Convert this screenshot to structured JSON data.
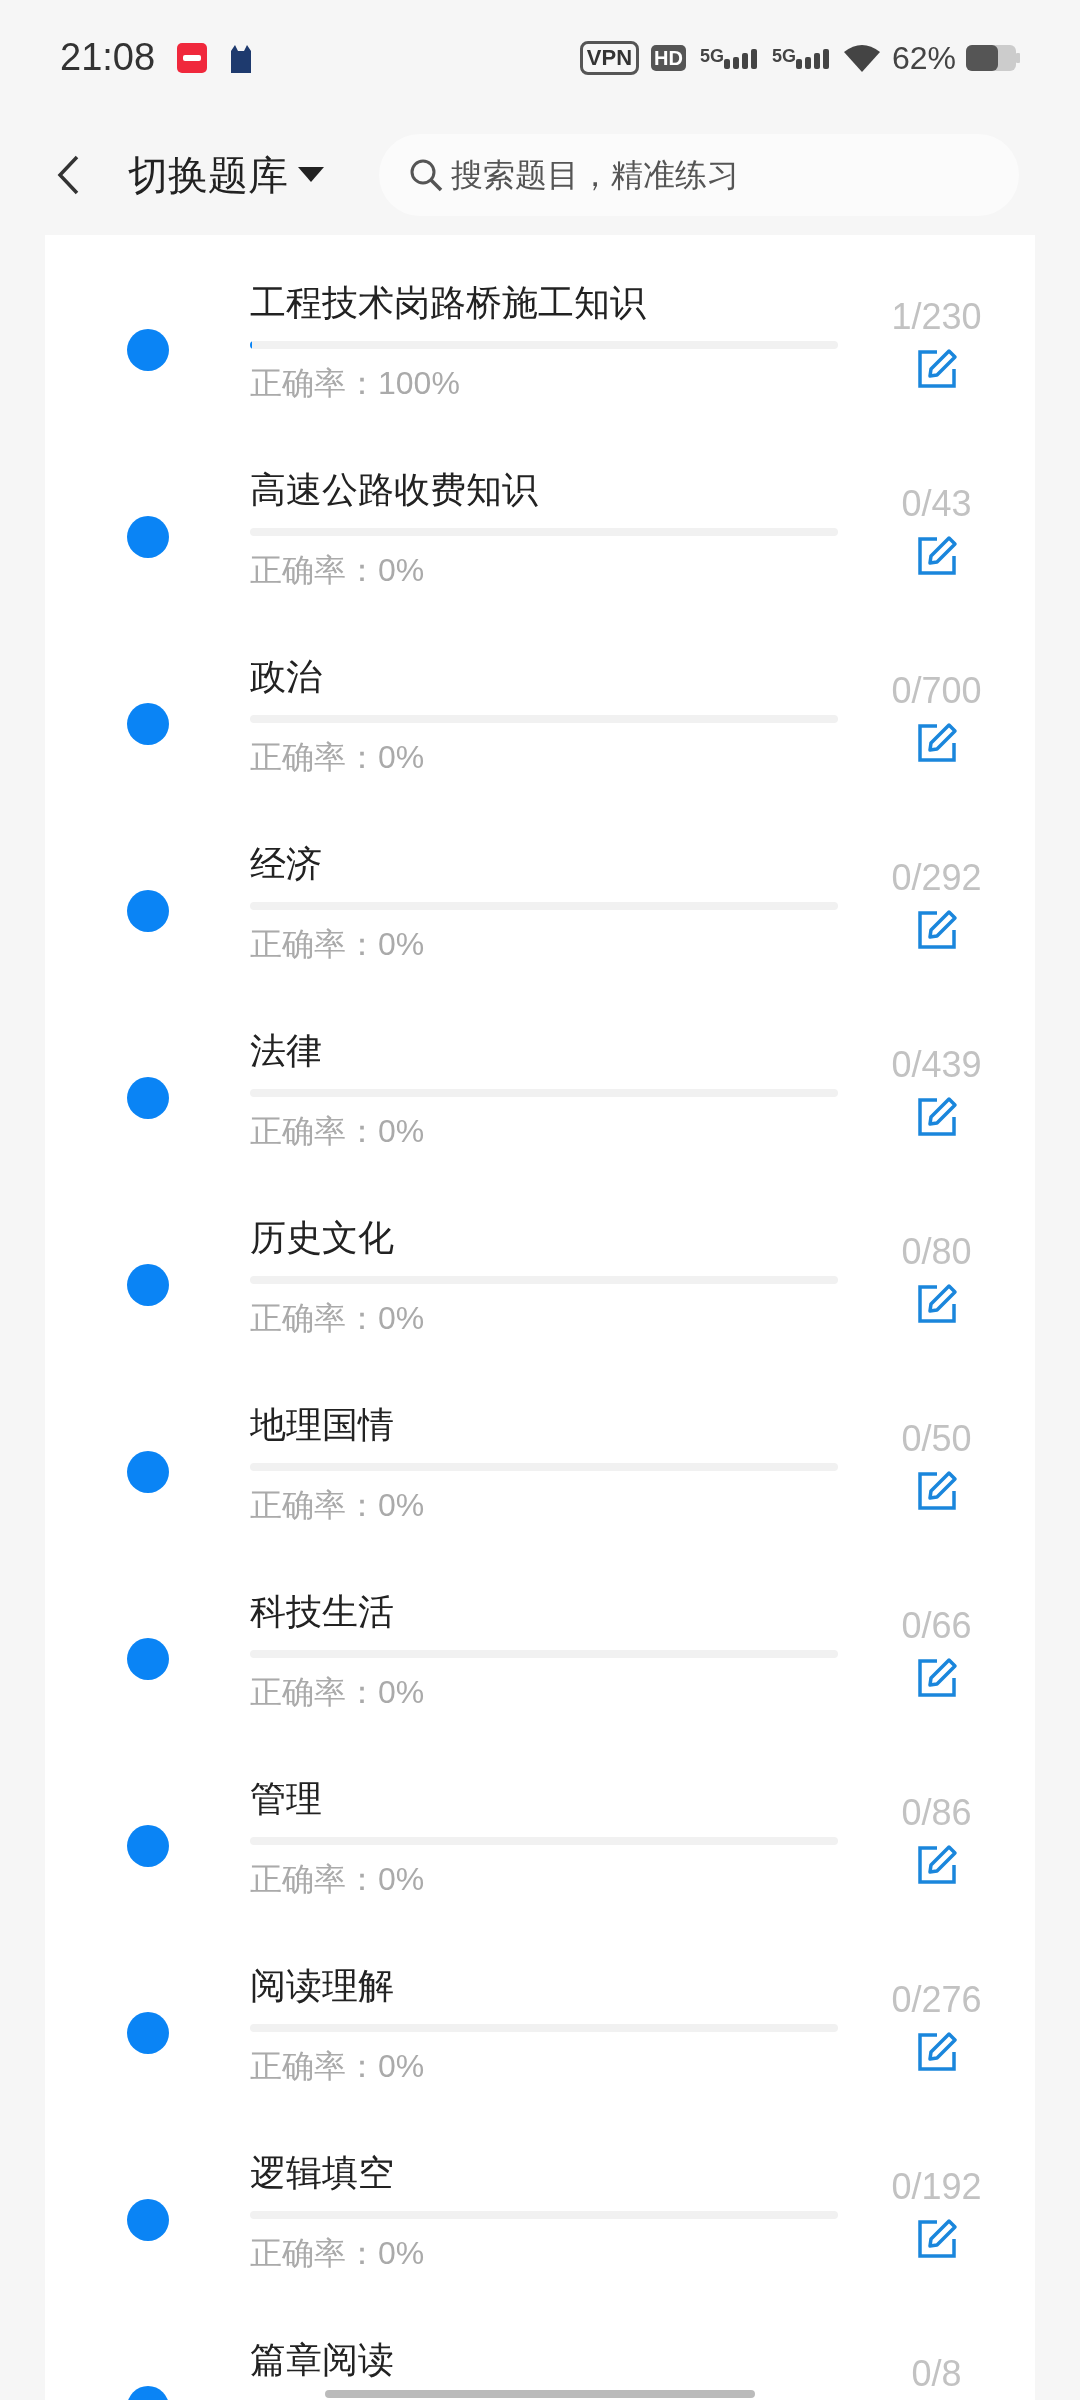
{
  "status_bar": {
    "time": "21:08",
    "vpn": "VPN",
    "hd": "HD",
    "network_labels": [
      "5G",
      "5G"
    ],
    "battery": "62%"
  },
  "header": {
    "title": "切换题库",
    "search": {
      "placeholder": "搜索题目，精准练习"
    }
  },
  "banks": [
    {
      "name": "工程技术岗路桥施工知识",
      "level": 0.004,
      "accuracy": "正确率：100%",
      "count": "1/230"
    },
    {
      "name": "高速公路收费知识",
      "level": 0,
      "accuracy": "正确率：0%",
      "count": "0/43"
    },
    {
      "name": "政治",
      "level": 0,
      "accuracy": "正确率：0%",
      "count": "0/700"
    },
    {
      "name": "经济",
      "level": 0,
      "accuracy": "正确率：0%",
      "count": "0/292"
    },
    {
      "name": "法律",
      "level": 0,
      "accuracy": "正确率：0%",
      "count": "0/439"
    },
    {
      "name": "历史文化",
      "level": 0,
      "accuracy": "正确率：0%",
      "count": "0/80"
    },
    {
      "name": "地理国情",
      "level": 0,
      "accuracy": "正确率：0%",
      "count": "0/50"
    },
    {
      "name": "科技生活",
      "level": 0,
      "accuracy": "正确率：0%",
      "count": "0/66"
    },
    {
      "name": "管理",
      "level": 0,
      "accuracy": "正确率：0%",
      "count": "0/86"
    },
    {
      "name": "阅读理解",
      "level": 0,
      "accuracy": "正确率：0%",
      "count": "0/276"
    },
    {
      "name": "逻辑填空",
      "level": 0,
      "accuracy": "正确率：0%",
      "count": "0/192"
    },
    {
      "name": "篇章阅读",
      "count": "0/8"
    }
  ]
}
